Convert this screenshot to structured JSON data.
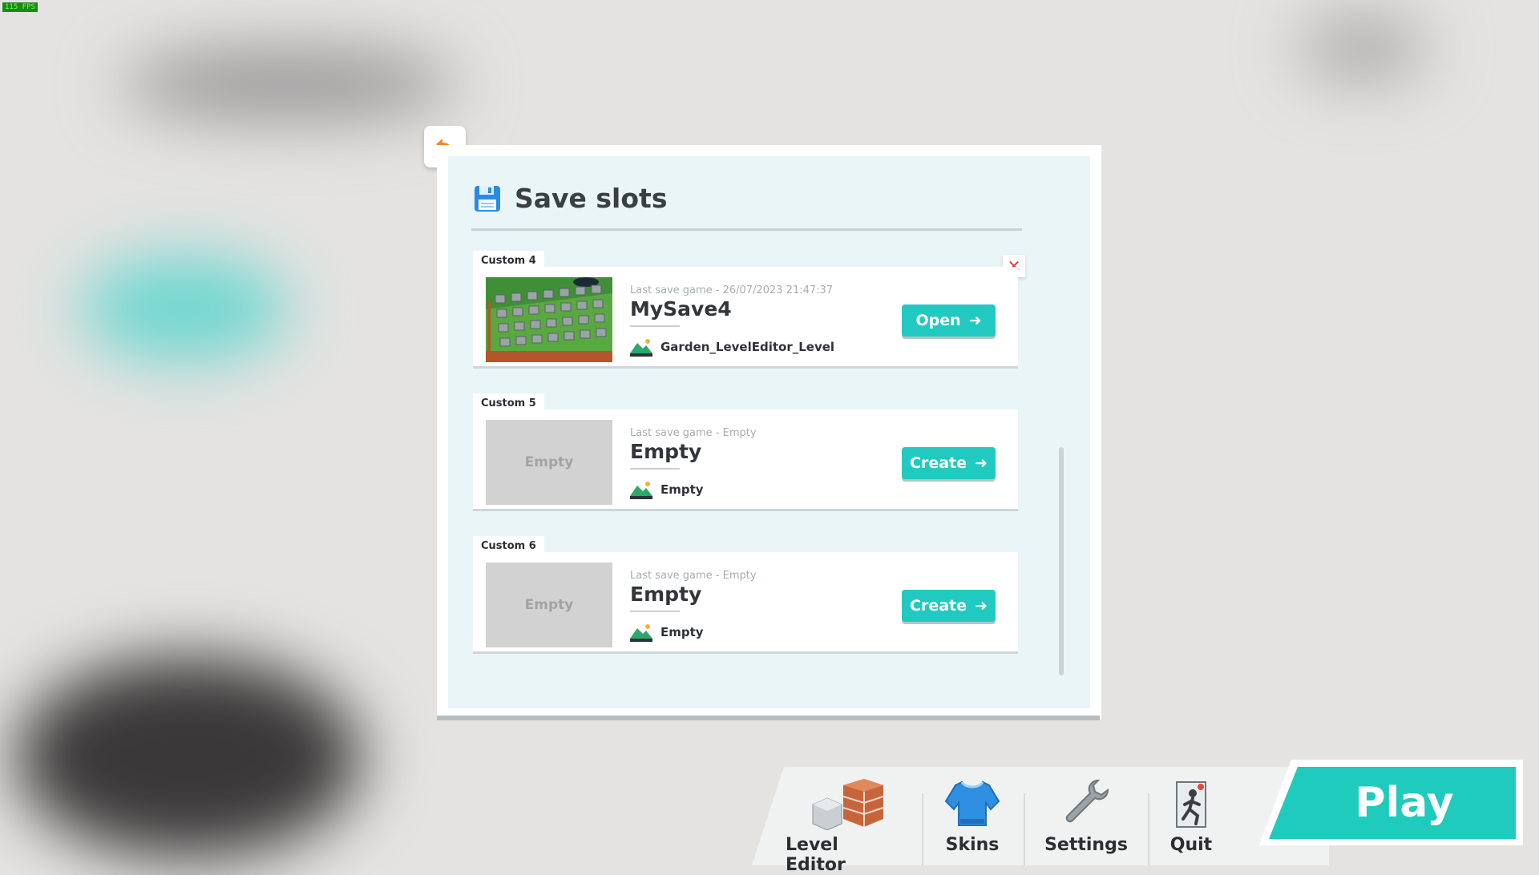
{
  "fps": "115 FPS",
  "panel": {
    "title": "Save slots",
    "title_icon": "floppy-disk-icon"
  },
  "slots": [
    {
      "tab": "Custom 4",
      "last_save": "Last save game - 26/07/2023 21:47:37",
      "name": "MySave4",
      "level": "Garden_LevelEditor_Level",
      "button": "Open",
      "thumbnail": "level-preview",
      "thumb_text": ""
    },
    {
      "tab": "Custom 5",
      "last_save": "Last save game - Empty",
      "name": "Empty",
      "level": "Empty",
      "button": "Create",
      "thumbnail": "empty",
      "thumb_text": "Empty"
    },
    {
      "tab": "Custom 6",
      "last_save": "Last save game - Empty",
      "name": "Empty",
      "level": "Empty",
      "button": "Create",
      "thumbnail": "empty",
      "thumb_text": "Empty"
    }
  ],
  "bottom_nav": {
    "level_editor": "Level Editor",
    "skins": "Skins",
    "settings": "Settings",
    "quit": "Quit",
    "play": "Play"
  },
  "colors": {
    "accent": "#21c9c1",
    "delete": "#e33b35",
    "back_arrow": "#f28a26"
  }
}
